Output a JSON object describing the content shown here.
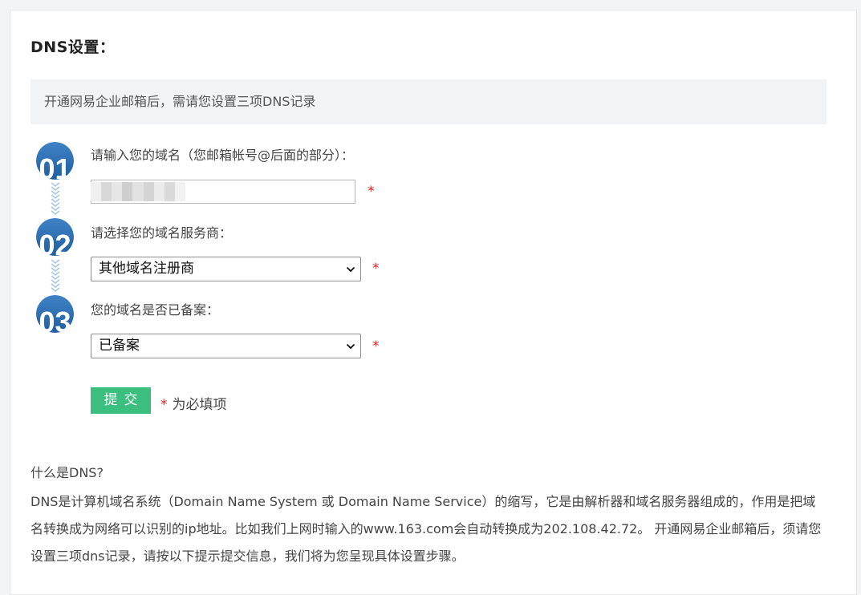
{
  "page": {
    "title": "DNS设置：",
    "notice": "开通网易企业邮箱后，需请您设置三项DNS记录"
  },
  "steps": [
    {
      "number": "01",
      "label": "请输入您的域名（您邮箱帐号@后面的部分）："
    },
    {
      "number": "02",
      "label": "请选择您的域名服务商："
    },
    {
      "number": "03",
      "label": "您的域名是否已备案："
    }
  ],
  "form": {
    "domain_value": "",
    "domain_placeholder": "",
    "provider_selected": "其他域名注册商",
    "filing_selected": "已备案",
    "required_mark": "*",
    "submit_label": "提交",
    "required_note": "为必填项"
  },
  "info": {
    "heading": "什么是DNS?",
    "body": "DNS是计算机域名系统（Domain Name System 或 Domain Name Service）的缩写，它是由解析器和域名服务器组成的，作用是把域名转换成为网络可以识别的ip地址。比如我们上网时输入的www.163.com会自动转换成为202.108.42.72。 开通网易企业邮箱后，须请您设置三项dns记录，请按以下提示提交信息，我们将为您呈现具体设置步骤。"
  },
  "colors": {
    "step_badge_blue": "#1f5fa0",
    "step_connector": "#a9c6e4",
    "submit_green": "#3bbf7f",
    "required_red": "#e02020",
    "notice_bg": "#f2f3f5"
  },
  "icons": {
    "step": "numbered-circle-icon",
    "connector": "double-chevron-down-icon",
    "dropdown": "chevron-down-icon"
  }
}
